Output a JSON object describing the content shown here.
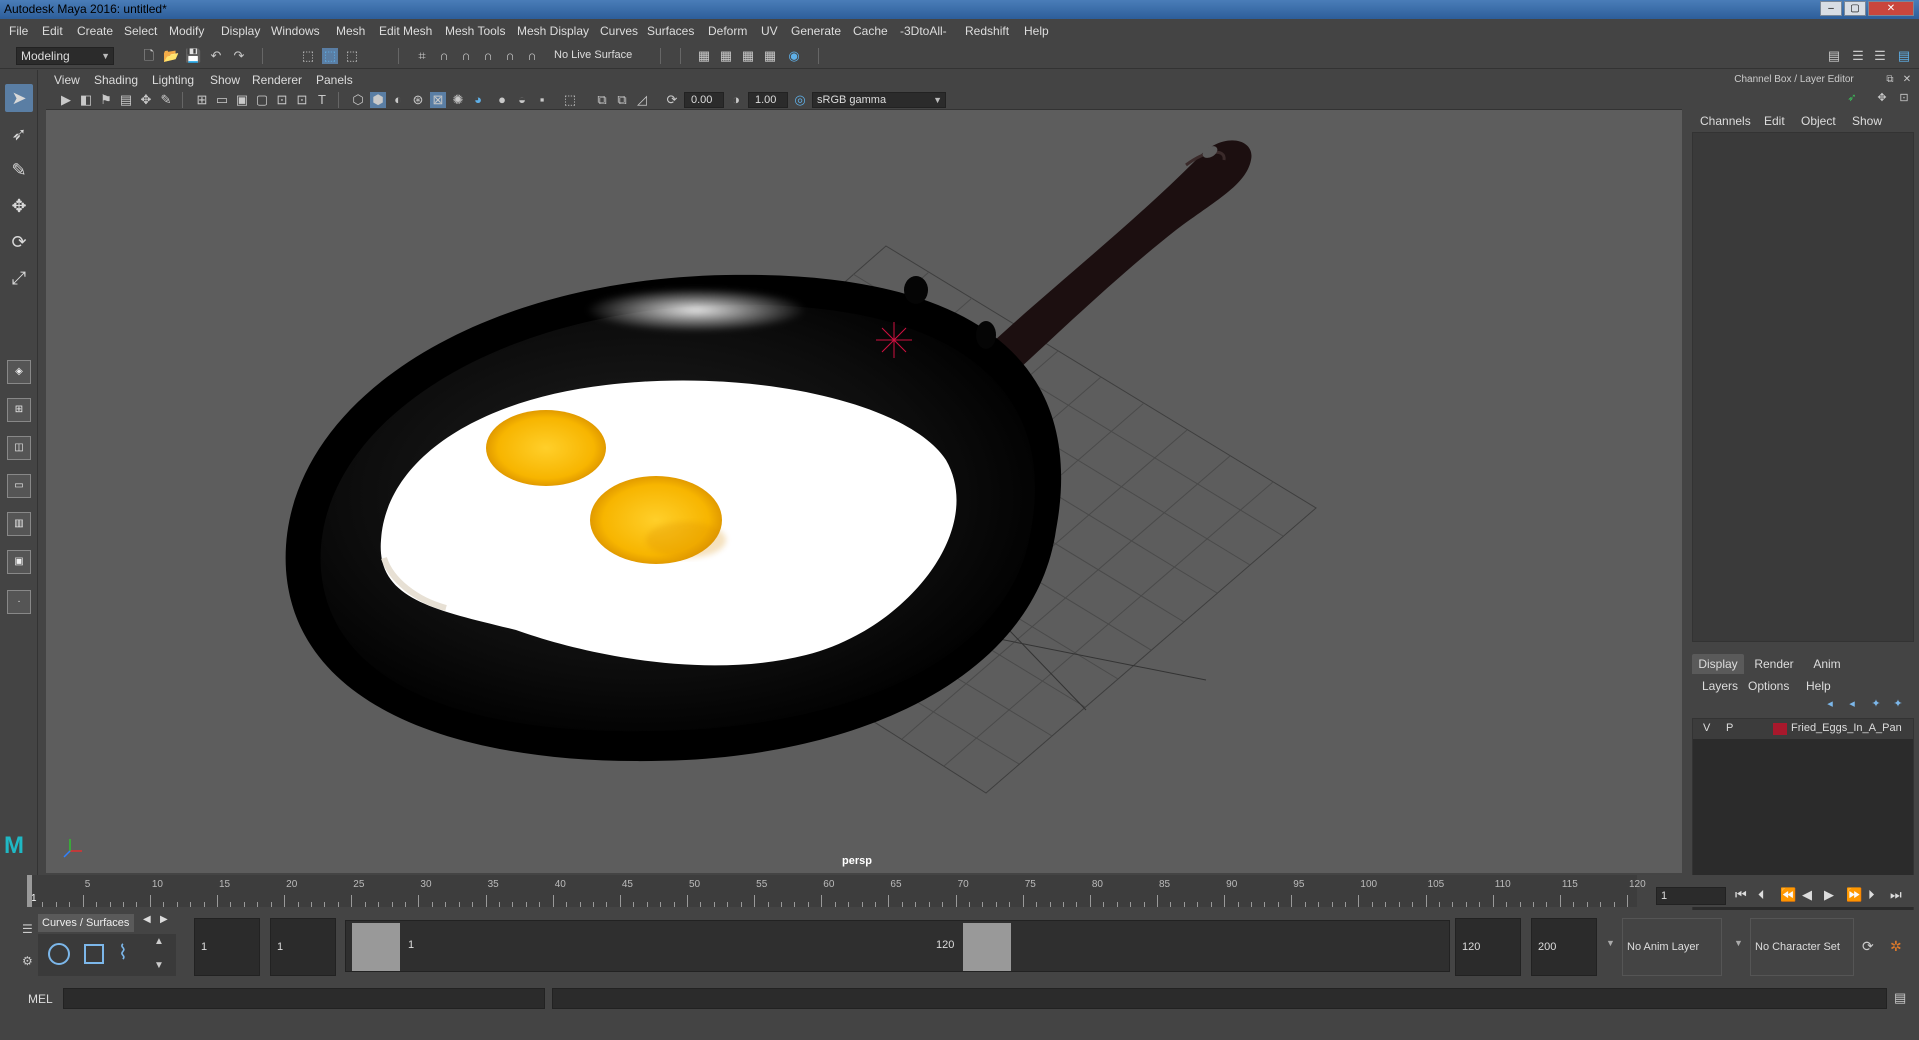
{
  "window": {
    "title": "Autodesk Maya 2016: untitled*",
    "minimize": "–",
    "maximize": "▢",
    "close": "✕"
  },
  "menubar": [
    "File",
    "Edit",
    "Create",
    "Select",
    "Modify",
    "Display",
    "Windows",
    "Mesh",
    "Edit Mesh",
    "Mesh Tools",
    "Mesh Display",
    "Curves",
    "Surfaces",
    "Deform",
    "UV",
    "Generate",
    "Cache",
    "-3DtoAll-",
    "Redshift",
    "Help"
  ],
  "status": {
    "mode": "Modeling",
    "live_surface": "No Live Surface"
  },
  "panel": {
    "menus": [
      "View",
      "Shading",
      "Lighting",
      "Show",
      "Renderer",
      "Panels"
    ],
    "exposure": "0.00",
    "gamma": "1.00",
    "colorspace": "sRGB gamma",
    "camera": "persp"
  },
  "channelbox": {
    "title": "Channel Box / Layer Editor",
    "menus": [
      "Channels",
      "Edit",
      "Object",
      "Show"
    ]
  },
  "layers": {
    "tabs": [
      "Display",
      "Render",
      "Anim"
    ],
    "menus": [
      "Layers",
      "Options",
      "Help"
    ],
    "items": [
      {
        "v": "V",
        "p": "P",
        "name": "Fried_Eggs_In_A_Pan",
        "color": "#a8182c"
      }
    ]
  },
  "timeline": {
    "labels": [
      "1",
      "5",
      "10",
      "15",
      "20",
      "25",
      "30",
      "35",
      "40",
      "45",
      "50",
      "55",
      "60",
      "65",
      "70",
      "75",
      "80",
      "85",
      "90",
      "95",
      "100",
      "105",
      "110",
      "115",
      "120"
    ],
    "current_frame": "1"
  },
  "range": {
    "shelf_tab": "Curves / Surfaces",
    "start": "1",
    "anim_start": "1",
    "range_start_label": "1",
    "range_end_label": "120",
    "end": "120",
    "anim_end": "200",
    "anim_layer": "No Anim Layer",
    "character_set": "No Character Set"
  },
  "command": {
    "language": "MEL"
  },
  "colors": {
    "viewport_bg": "#5d5d5d",
    "accent": "#5a7ea4",
    "layer_color": "#a8182c"
  }
}
